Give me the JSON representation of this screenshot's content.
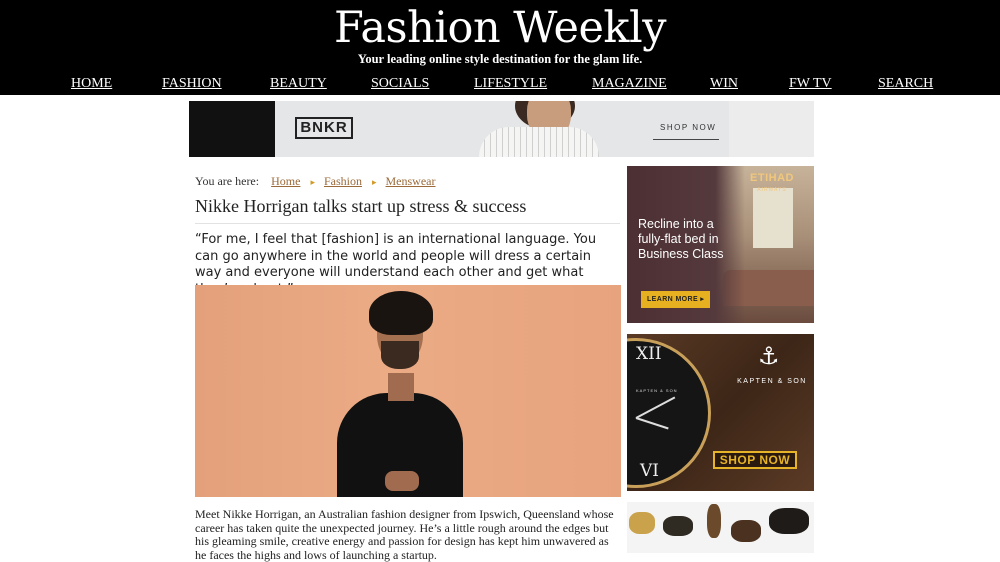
{
  "site": {
    "title": "Fashion Weekly",
    "tagline": "Your leading online style destination for the glam life."
  },
  "nav": {
    "home": "HOME",
    "fashion": "FASHION",
    "beauty": "BEAUTY",
    "socials": "SOCIALS",
    "lifestyle": "LIFESTYLE",
    "magazine": "MAGAZINE",
    "win": "WIN",
    "fwtv": "FW TV",
    "search": "SEARCH"
  },
  "banner_ad": {
    "brand": "BNKR",
    "cta": "SHOP NOW"
  },
  "breadcrumb": {
    "prefix": "You are here:",
    "items": [
      "Home",
      "Fashion",
      "Menswear"
    ]
  },
  "article": {
    "title": "Nikke Horrigan talks start up stress & success",
    "pullquote": "“For me, I feel that [fashion] is an international language. You can go anywhere in the world and people will dress a certain way and everyone will understand each other and get what they’re about.”",
    "body": "Meet Nikke Horrigan, an Australian fashion designer from Ipswich, Queensland whose career has taken quite the unexpected journey. He’s a little rough around the edges but his gleaming smile, creative energy and passion for design has kept him unwavered as he faces the highs and lows of launching a startup."
  },
  "sidebar": {
    "etihad": {
      "logo": "ETIHAD",
      "logo_sub": "AIRWAYS",
      "headline": "Recline into a fully-flat bed in Business Class",
      "cta": "LEARN MORE ▸"
    },
    "kapten": {
      "numeral_top": "XII",
      "numeral_bottom": "VI",
      "dial_brand": "KAPTEN & SON",
      "anchor": "⚓",
      "brand": "KAPTEN & SON",
      "cta": "SHOP NOW"
    }
  }
}
